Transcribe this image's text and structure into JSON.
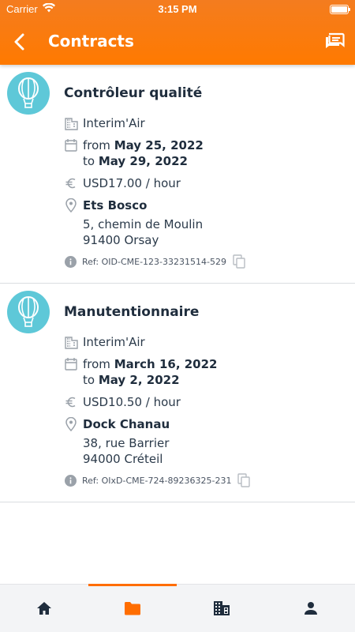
{
  "status_bar": {
    "carrier": "Carrier",
    "time": "3:15 PM"
  },
  "nav": {
    "title": "Contracts",
    "back_icon": "chevron-left-icon",
    "chat_icon": "chat-icon"
  },
  "colors": {
    "accent": "#ff7a00",
    "avatar": "#5ec8d8",
    "text": "#1f2d3d",
    "icon_gray": "#9aa1a9"
  },
  "contracts": [
    {
      "title": "Contrôleur qualité",
      "agency": "Interim'Air",
      "from_label": "from",
      "from_date": "May 25, 2022",
      "to_label": "to",
      "to_date": "May 29, 2022",
      "rate": "USD17.00 / hour",
      "company": "Ets Bosco",
      "address_line1": "5, chemin de Moulin",
      "address_line2": "91400 Orsay",
      "ref": "Ref: OID-CME-123-33231514-529"
    },
    {
      "title": "Manutentionnaire",
      "agency": "Interim'Air",
      "from_label": "from",
      "from_date": "March 16, 2022",
      "to_label": "to",
      "to_date": "May 2, 2022",
      "rate": "USD10.50 / hour",
      "company": "Dock Chanau",
      "address_line1": "38, rue Barrier",
      "address_line2": "94000 Créteil",
      "ref": "Ref: OIxD-CME-724-89236325-231"
    }
  ],
  "tabbar": {
    "tabs": [
      {
        "icon": "home-icon",
        "active": false
      },
      {
        "icon": "folder-icon",
        "active": true
      },
      {
        "icon": "building-icon",
        "active": false
      },
      {
        "icon": "person-icon",
        "active": false
      }
    ]
  }
}
